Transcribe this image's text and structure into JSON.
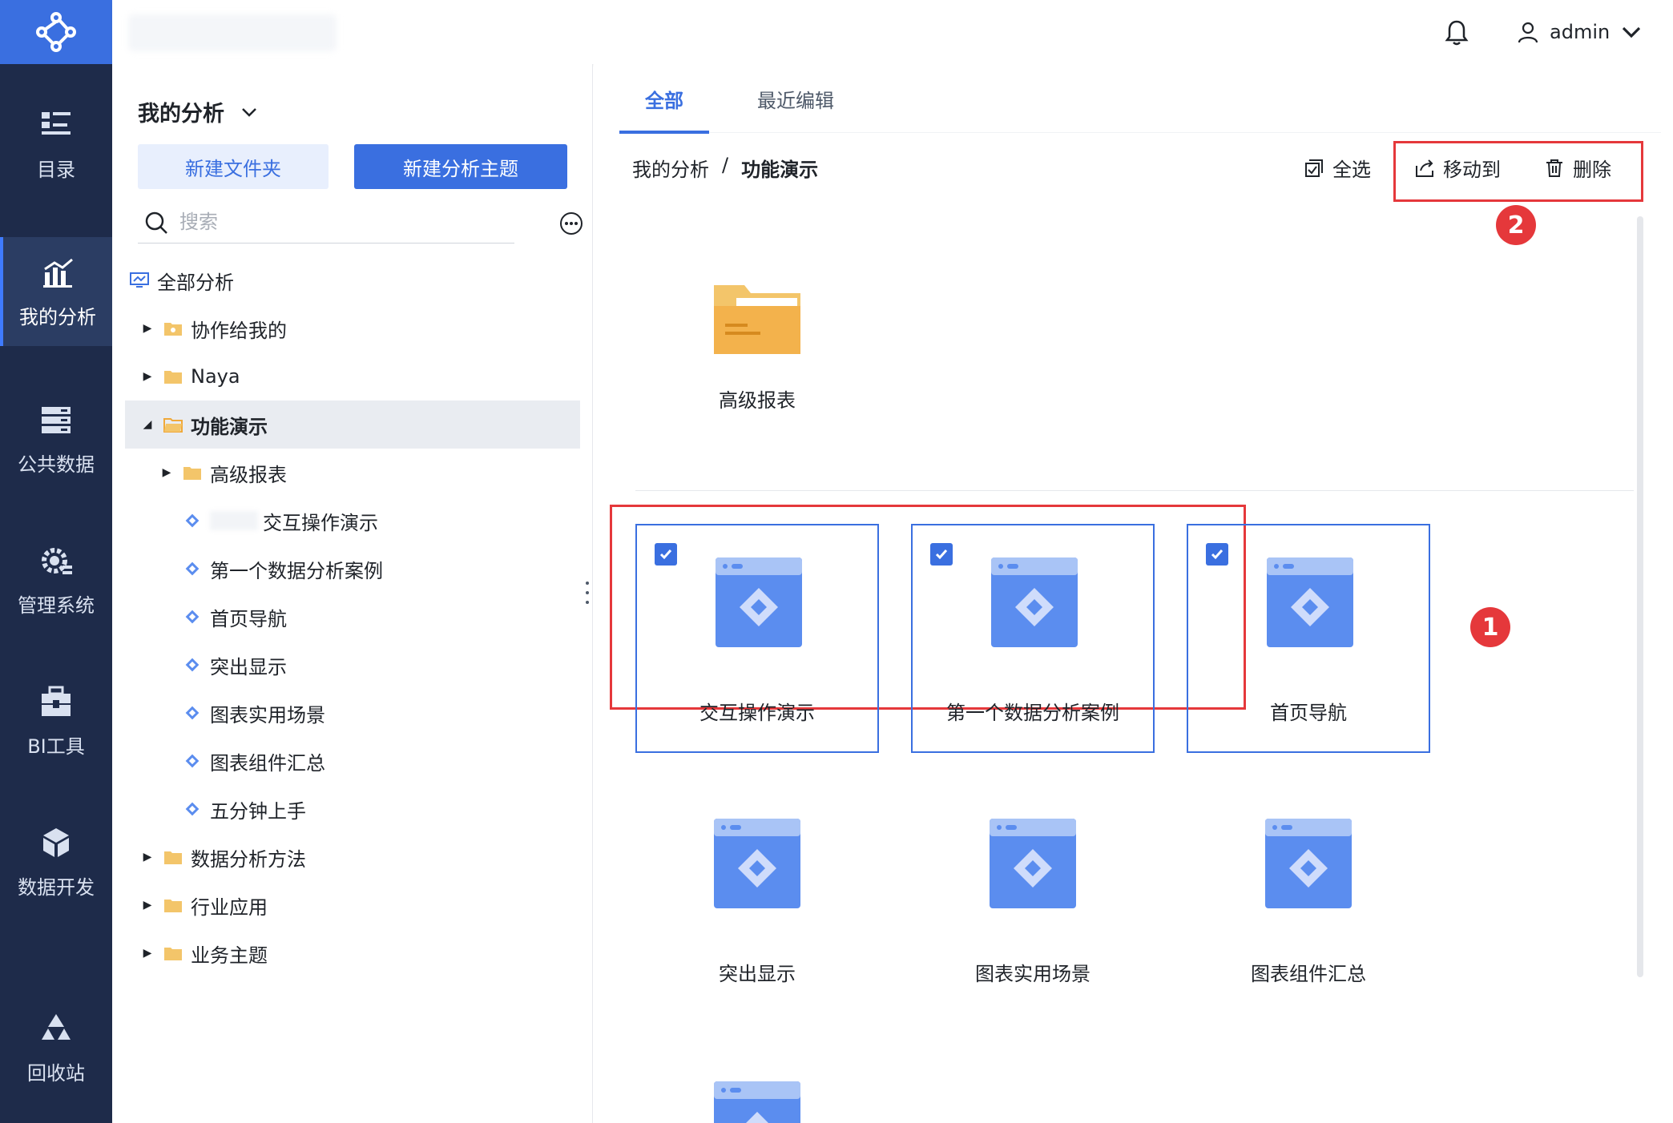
{
  "header": {
    "user_name": "admin",
    "bell_icon": "bell-icon",
    "user_icon": "user-icon"
  },
  "nav": {
    "items": [
      {
        "label": "目录",
        "icon": "catalog-icon"
      },
      {
        "label": "我的分析",
        "icon": "analysis-icon",
        "active": true
      },
      {
        "label": "公共数据",
        "icon": "database-icon"
      },
      {
        "label": "管理系统",
        "icon": "gear-icon"
      },
      {
        "label": "BI工具",
        "icon": "toolbox-icon"
      },
      {
        "label": "数据开发",
        "icon": "cube-icon"
      },
      {
        "label": "回收站",
        "icon": "recycle-icon"
      }
    ]
  },
  "tree_panel": {
    "title": "我的分析",
    "new_folder_label": "新建文件夹",
    "new_theme_label": "新建分析主题",
    "search_placeholder": "搜索",
    "items": [
      {
        "label": "全部分析",
        "type": "root"
      },
      {
        "label": "协作给我的",
        "type": "folder"
      },
      {
        "label": "Naya",
        "type": "folder"
      },
      {
        "label": "功能演示",
        "type": "folder",
        "selected": true
      },
      {
        "label": "高级报表",
        "type": "folder"
      },
      {
        "label": "交互操作演示",
        "type": "theme"
      },
      {
        "label": "第一个数据分析案例",
        "type": "theme"
      },
      {
        "label": "首页导航",
        "type": "theme"
      },
      {
        "label": "突出显示",
        "type": "theme"
      },
      {
        "label": "图表实用场景",
        "type": "theme"
      },
      {
        "label": "图表组件汇总",
        "type": "theme"
      },
      {
        "label": "五分钟上手",
        "type": "theme"
      },
      {
        "label": "数据分析方法",
        "type": "folder"
      },
      {
        "label": "行业应用",
        "type": "folder"
      },
      {
        "label": "业务主题",
        "type": "folder"
      }
    ]
  },
  "content": {
    "tabs": [
      "全部",
      "最近编辑"
    ],
    "breadcrumb": {
      "root": "我的分析",
      "separator": "/",
      "current": "功能演示"
    },
    "toolbar": {
      "select_all": "全选",
      "move_to": "移动到",
      "delete": "删除"
    },
    "annotations": {
      "badge_1": "1",
      "badge_2": "2"
    },
    "folder_card": {
      "label": "高级报表"
    },
    "cards": [
      {
        "label": "交互操作演示",
        "checked": true
      },
      {
        "label": "第一个数据分析案例",
        "checked": true
      },
      {
        "label": "首页导航",
        "checked": true
      },
      {
        "label": "突出显示",
        "checked": false
      },
      {
        "label": "图表实用场景",
        "checked": false
      },
      {
        "label": "图表组件汇总",
        "checked": false
      }
    ]
  },
  "colors": {
    "nav_bg": "#1e2b4a",
    "accent": "#3a6fe0",
    "highlight_red": "#e5383b",
    "folder": "#f3b24c"
  }
}
